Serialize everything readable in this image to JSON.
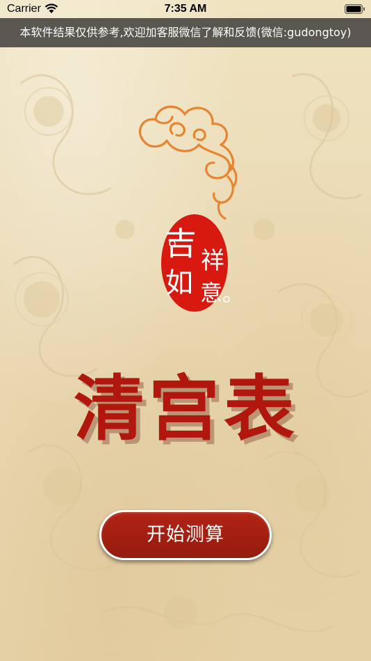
{
  "status_bar": {
    "carrier": "Carrier",
    "time": "7:35 AM"
  },
  "banner": {
    "text": "本软件结果仅供参考,欢迎加客服微信了解和反馈(微信:gudongtoy)"
  },
  "logo": {
    "characters": [
      "吉",
      "祥",
      "如",
      "意"
    ],
    "color": "#d8190f"
  },
  "title": {
    "text": "清宫表",
    "color": "#b2170e"
  },
  "start_button": {
    "label": "开始测算",
    "color": "#a3200f"
  },
  "icons": [
    "wifi-icon",
    "battery-icon",
    "cloud-icon"
  ]
}
